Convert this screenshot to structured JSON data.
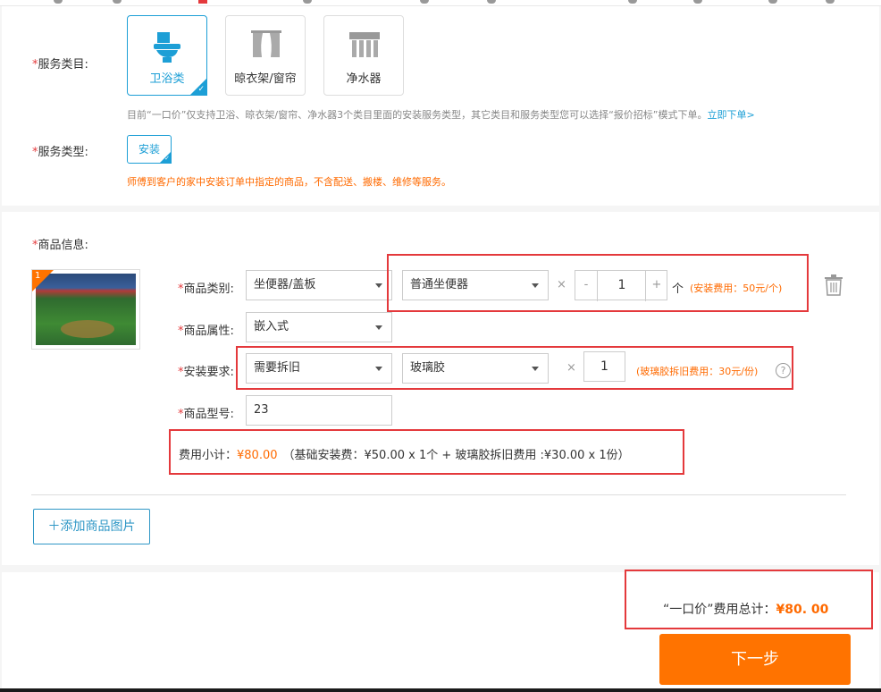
{
  "service": {
    "category_label": "服务类目:",
    "categories": [
      {
        "label": "卫浴类",
        "icon": "toilet-icon",
        "selected": true
      },
      {
        "label": "晾衣架/窗帘",
        "icon": "curtain-icon",
        "selected": false
      },
      {
        "label": "净水器",
        "icon": "water-purifier-icon",
        "selected": false
      }
    ],
    "category_note": "目前“一口价”仅支持卫浴、晾衣架/窗帘、净水器3个类目里面的安装服务类型，其它类目和服务类型您可以选择“报价招标”模式下单。",
    "category_note_link": "立即下单>",
    "type_label": "服务类型:",
    "type_option": "安装",
    "type_note": "师傅到客户的家中安装订单中指定的商品，不含配送、搬楼、维修等服务。"
  },
  "product": {
    "section_label": "商品信息:",
    "image_badge": "1",
    "category_label": "商品类别:",
    "category_value": "坐便器/盖板",
    "subcategory_value": "普通坐便器",
    "times": "×",
    "minus": "-",
    "plus": "+",
    "quantity": "1",
    "quantity_unit": "个",
    "install_fee_note": "(安装费用：50元/个)",
    "attribute_label": "商品属性:",
    "attribute_value": "嵌入式",
    "install_req_label": "安装要求:",
    "install_req_value": "需要拆旧",
    "material_value": "玻璃胶",
    "material_qty": "1",
    "material_fee_note": "(玻璃胶拆旧费用：30元/份)",
    "help": "?",
    "model_label": "商品型号:",
    "model_value": "23",
    "subtotal_label": "费用小计：",
    "subtotal_value": "¥80.00",
    "subtotal_detail": "（基础安装费：¥50.00 x 1个 + 玻璃胶拆旧费用 :¥30.00 x 1份）",
    "add_image_button": "添加商品图片",
    "add_icon": "＋"
  },
  "footer": {
    "total_label": "“一口价”费用总计：",
    "total_value": "¥80. 00",
    "next_button": "下一步"
  },
  "colors": {
    "accent_blue": "#1d9fd6",
    "highlight_red": "#e4393c",
    "price_orange": "#ff6a00",
    "next_button": "#ff7300"
  }
}
